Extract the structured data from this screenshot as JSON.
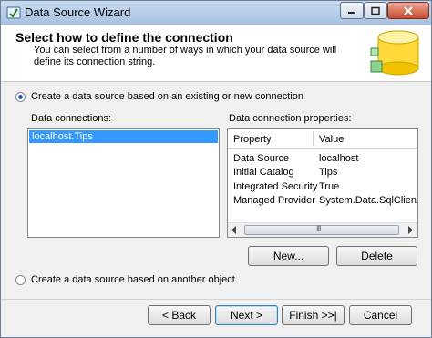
{
  "window": {
    "title": "Data Source Wizard"
  },
  "header": {
    "title": "Select how to define the connection",
    "description": "You can select from a number of ways in which your data source will define its connection string."
  },
  "options": {
    "existing_label": "Create a data source based on an existing or new connection",
    "other_label": "Create a data source based on another object"
  },
  "connections": {
    "label": "Data connections:",
    "items": [
      "localhost.Tips"
    ]
  },
  "properties": {
    "label": "Data connection properties:",
    "columns": [
      "Property",
      "Value"
    ],
    "rows": [
      {
        "property": "Data Source",
        "value": "localhost"
      },
      {
        "property": "Initial Catalog",
        "value": "Tips"
      },
      {
        "property": "Integrated Security",
        "value": "True"
      },
      {
        "property": "Managed Provider",
        "value": "System.Data.SqlClient"
      }
    ],
    "scroll_grip": "III"
  },
  "buttons": {
    "new": "New...",
    "delete": "Delete",
    "back": "< Back",
    "next": "Next >",
    "finish": "Finish >>|",
    "cancel": "Cancel"
  },
  "colors": {
    "selection": "#3399ff",
    "header_bg": "#ffffff",
    "dialog_bg": "#f0f0f0"
  }
}
